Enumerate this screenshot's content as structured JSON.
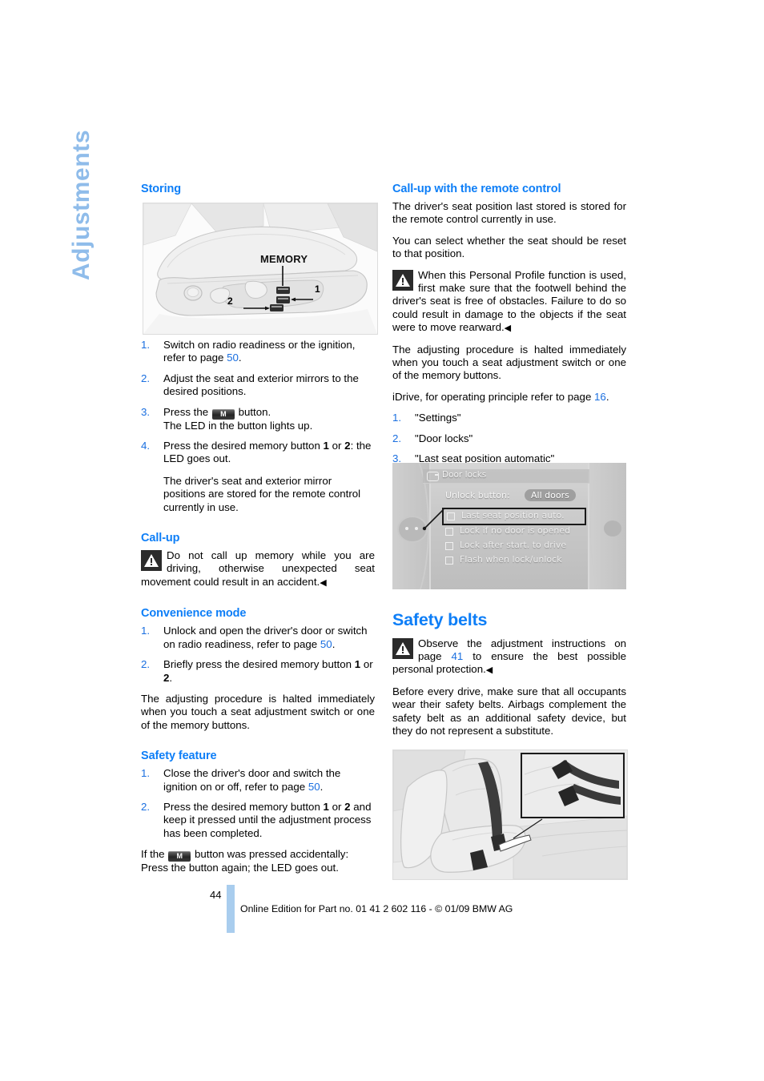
{
  "chapter_tab": "Adjustments",
  "left_column": {
    "storing": {
      "heading": "Storing",
      "figure": {
        "memory_label": "MEMORY",
        "callout_1": "1",
        "callout_2": "2"
      },
      "steps": [
        {
          "text_before": "Switch on radio readiness or the ignition, refer to page ",
          "link": "50",
          "text_after": "."
        },
        {
          "text_before": "Adjust the seat and exterior mirrors to the desired positions.",
          "link": "",
          "text_after": ""
        },
        {
          "text_before": "Press the ",
          "button": "M",
          "text_after": " button.",
          "second_line": "The LED in the button lights up."
        },
        {
          "text_before": "Press the desired memory button ",
          "bold_1": "1",
          "mid": " or ",
          "bold_2": "2",
          "text_after": ": the LED goes out.",
          "extra_paragraph": "The driver's seat and exterior mirror positions are stored for the remote control currently in use."
        }
      ]
    },
    "callup": {
      "heading": "Call-up",
      "warning": "Do not call up memory while you are driving, otherwise unexpected seat movement could result in an accident.",
      "end_mark": "◀"
    },
    "convenience": {
      "heading": "Convenience mode",
      "steps": [
        {
          "text_before": "Unlock and open the driver's door or switch on radio readiness, refer to page ",
          "link": "50",
          "text_after": "."
        },
        {
          "text_before": "Briefly press the desired memory button ",
          "bold_1": "1",
          "mid": " or ",
          "bold_2": "2",
          "text_after": "."
        }
      ],
      "note": "The adjusting procedure is halted immediately when you touch a seat adjustment switch or one of the memory buttons."
    },
    "safety_feature": {
      "heading": "Safety feature",
      "steps": [
        {
          "text_before": "Close the driver's door and switch the ignition on or off, refer to page ",
          "link": "50",
          "text_after": "."
        },
        {
          "text_before": "Press the desired memory button ",
          "bold_1": "1",
          "mid": " or ",
          "bold_2": "2",
          "text_after": " and keep it pressed until the adjustment process has been completed."
        }
      ],
      "note_before": "If the ",
      "note_button": "M",
      "note_after": " button was pressed accidentally: Press the button again; the LED goes out."
    }
  },
  "right_column": {
    "callup_remote": {
      "heading": "Call-up with the remote control",
      "para_1": "The driver's seat position last stored is stored for the remote control currently in use.",
      "para_2": "You can select whether the seat should be reset to that position.",
      "warning": "When this Personal Profile function is used, first make sure that the footwell behind the driver's seat is free of obstacles. Failure to do so could result in damage to the objects if the seat were to move rearward.",
      "end_mark": "◀",
      "para_3": "The adjusting procedure is halted immediately when you touch a seat adjustment switch or one of the memory buttons.",
      "idrive_intro_before": "iDrive, for operating principle refer to page ",
      "idrive_intro_link": "16",
      "idrive_intro_after": ".",
      "menu_steps": [
        "\"Settings\"",
        "\"Door locks\"",
        "\"Last seat position automatic\""
      ]
    },
    "idrive_screen": {
      "title": "Door locks",
      "unlock_label": "Unlock button:",
      "unlock_value": "All doors",
      "options": [
        "Last seat position auto.",
        "Lock if no door is opened",
        "Lock after start. to drive",
        "Flash when lock/unlock"
      ],
      "selected_index": 0
    },
    "safety_belts": {
      "heading": "Safety belts",
      "warning_before": "Observe the adjustment instructions on page ",
      "warning_link": "41",
      "warning_after": " to ensure the best possible personal protection.",
      "end_mark": "◀",
      "para": "Before every drive, make sure that all occupants wear their safety belts. Airbags complement the safety belt as an additional safety device, but they do not represent a substitute."
    }
  },
  "footer": {
    "page_number": "44",
    "edition_text": "Online Edition for Part no. 01 41 2 602 116 - © 01/09 BMW AG"
  },
  "colors": {
    "heading_blue": "#0d7ef7",
    "link_blue": "#1a6fe0",
    "tab_blue": "#8fbcea",
    "footer_bar": "#a9cdee"
  }
}
